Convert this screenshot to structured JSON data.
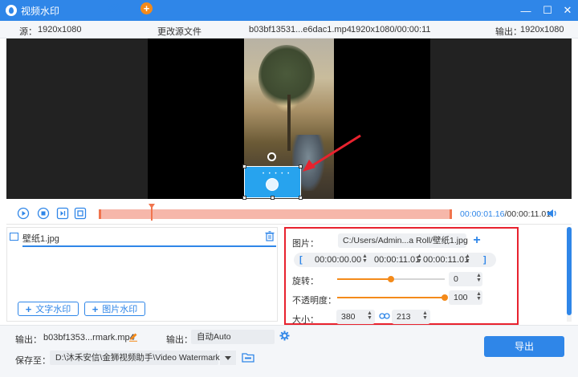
{
  "window": {
    "title": "视频水印",
    "controls": {
      "minimize": "—",
      "maximize": "☐",
      "close": "✕"
    }
  },
  "infobar": {
    "source_label": "源：",
    "source_res": "1920x1080",
    "change_source": "更改源文件",
    "file_name": "b03bf13531...e6dac1.mp4",
    "file_res_duration": "1920x1080/00:00:11",
    "output_label": "输出：",
    "output_res": "1920x1080"
  },
  "watermark_preview": {
    "dots": "• • • • •"
  },
  "timeline": {
    "current": "00:00:01.16",
    "separator": "/",
    "total": "00:00:11.01",
    "playhead_fraction": 0.146
  },
  "watermark_list": {
    "items": [
      {
        "name": "壁纸1.jpg"
      }
    ],
    "add_text": "文字水印",
    "add_image": "图片水印"
  },
  "properties": {
    "image_label": "图片：",
    "image_path": "C:/Users/Admin...a Roll/壁纸1.jpg",
    "start_time": "00:00:00.00",
    "end_time": "00:00:11.01",
    "duration": "00:00:11.01",
    "bracket_open": "[",
    "bracket_close": "]",
    "rotate_label": "旋转：",
    "rotate_value": "0",
    "rotate_fraction": 0.5,
    "opacity_label": "不透明度：",
    "opacity_value": "100",
    "opacity_fraction": 1.0,
    "size_label": "大小：",
    "width": "380",
    "height": "213"
  },
  "bottom": {
    "output_label": "输出：",
    "output_file": "b03bf1353...rmark.mp4",
    "format_label": "输出：",
    "format_value": "自动Auto",
    "save_label": "保存至：",
    "save_path": "D:\\沐禾安信\\金狮视频助手\\Video Watermark",
    "export": "导出"
  },
  "colors": {
    "accent": "#2f86e8",
    "orange": "#f48a1a",
    "highlight": "#e8222e"
  }
}
